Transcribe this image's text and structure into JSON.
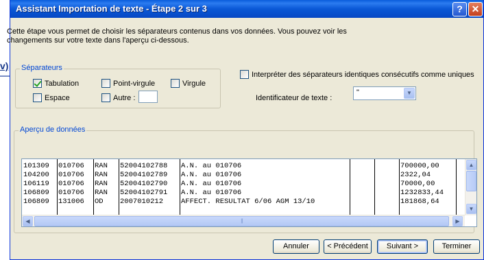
{
  "background": {
    "link_fragment": "v)"
  },
  "window": {
    "title": "Assistant Importation de texte - Étape 2 sur 3",
    "help_glyph": "?",
    "close_glyph": "✕"
  },
  "intro": {
    "line1": "Cette étape vous permet de choisir les séparateurs contenus dans vos données. Vous pouvez voir les",
    "line2": "changements sur votre texte dans l'aperçu ci-dessous."
  },
  "separators": {
    "legend": "Séparateurs",
    "options": [
      {
        "label": "Tabulation",
        "checked": true
      },
      {
        "label": "Point-virgule",
        "checked": false
      },
      {
        "label": "Virgule",
        "checked": false
      },
      {
        "label": "Espace",
        "checked": false
      },
      {
        "label": "Autre :",
        "checked": false
      }
    ],
    "other_value": ""
  },
  "consecutive": {
    "label": "Interpréter des séparateurs identiques consécutifs comme uniques",
    "checked": false
  },
  "text_qualifier": {
    "label": "Identificateur de texte :",
    "value": "\""
  },
  "preview": {
    "legend": "Aperçu de données",
    "rows": [
      [
        "101309",
        "010706",
        "RAN",
        "52004102788",
        "A.N. au 010706",
        "",
        "",
        "700000,00"
      ],
      [
        "104200",
        "010706",
        "RAN",
        "52004102789",
        "A.N. au 010706",
        "",
        "",
        "2322,04"
      ],
      [
        "106119",
        "010706",
        "RAN",
        "52004102790",
        "A.N. au 010706",
        "",
        "",
        "70000,00"
      ],
      [
        "106809",
        "010706",
        "RAN",
        "52004102791",
        "A.N. au 010706",
        "",
        "",
        "1232833,44"
      ],
      [
        "106809",
        "131006",
        "OD",
        "2007010212",
        "AFFECT. RESULTAT 6/06   AGM 13/10",
        "",
        "",
        "181868,64"
      ]
    ],
    "hscroll_grip": "|||"
  },
  "buttons": {
    "cancel": "Annuler",
    "previous": "< Précédent",
    "next": "Suivant >",
    "finish": "Terminer"
  },
  "colors": {
    "title_bar": "#0a5ddb",
    "dialog_bg": "#ece9d8",
    "group_label": "#0046d5",
    "checkmark": "#21a121"
  }
}
